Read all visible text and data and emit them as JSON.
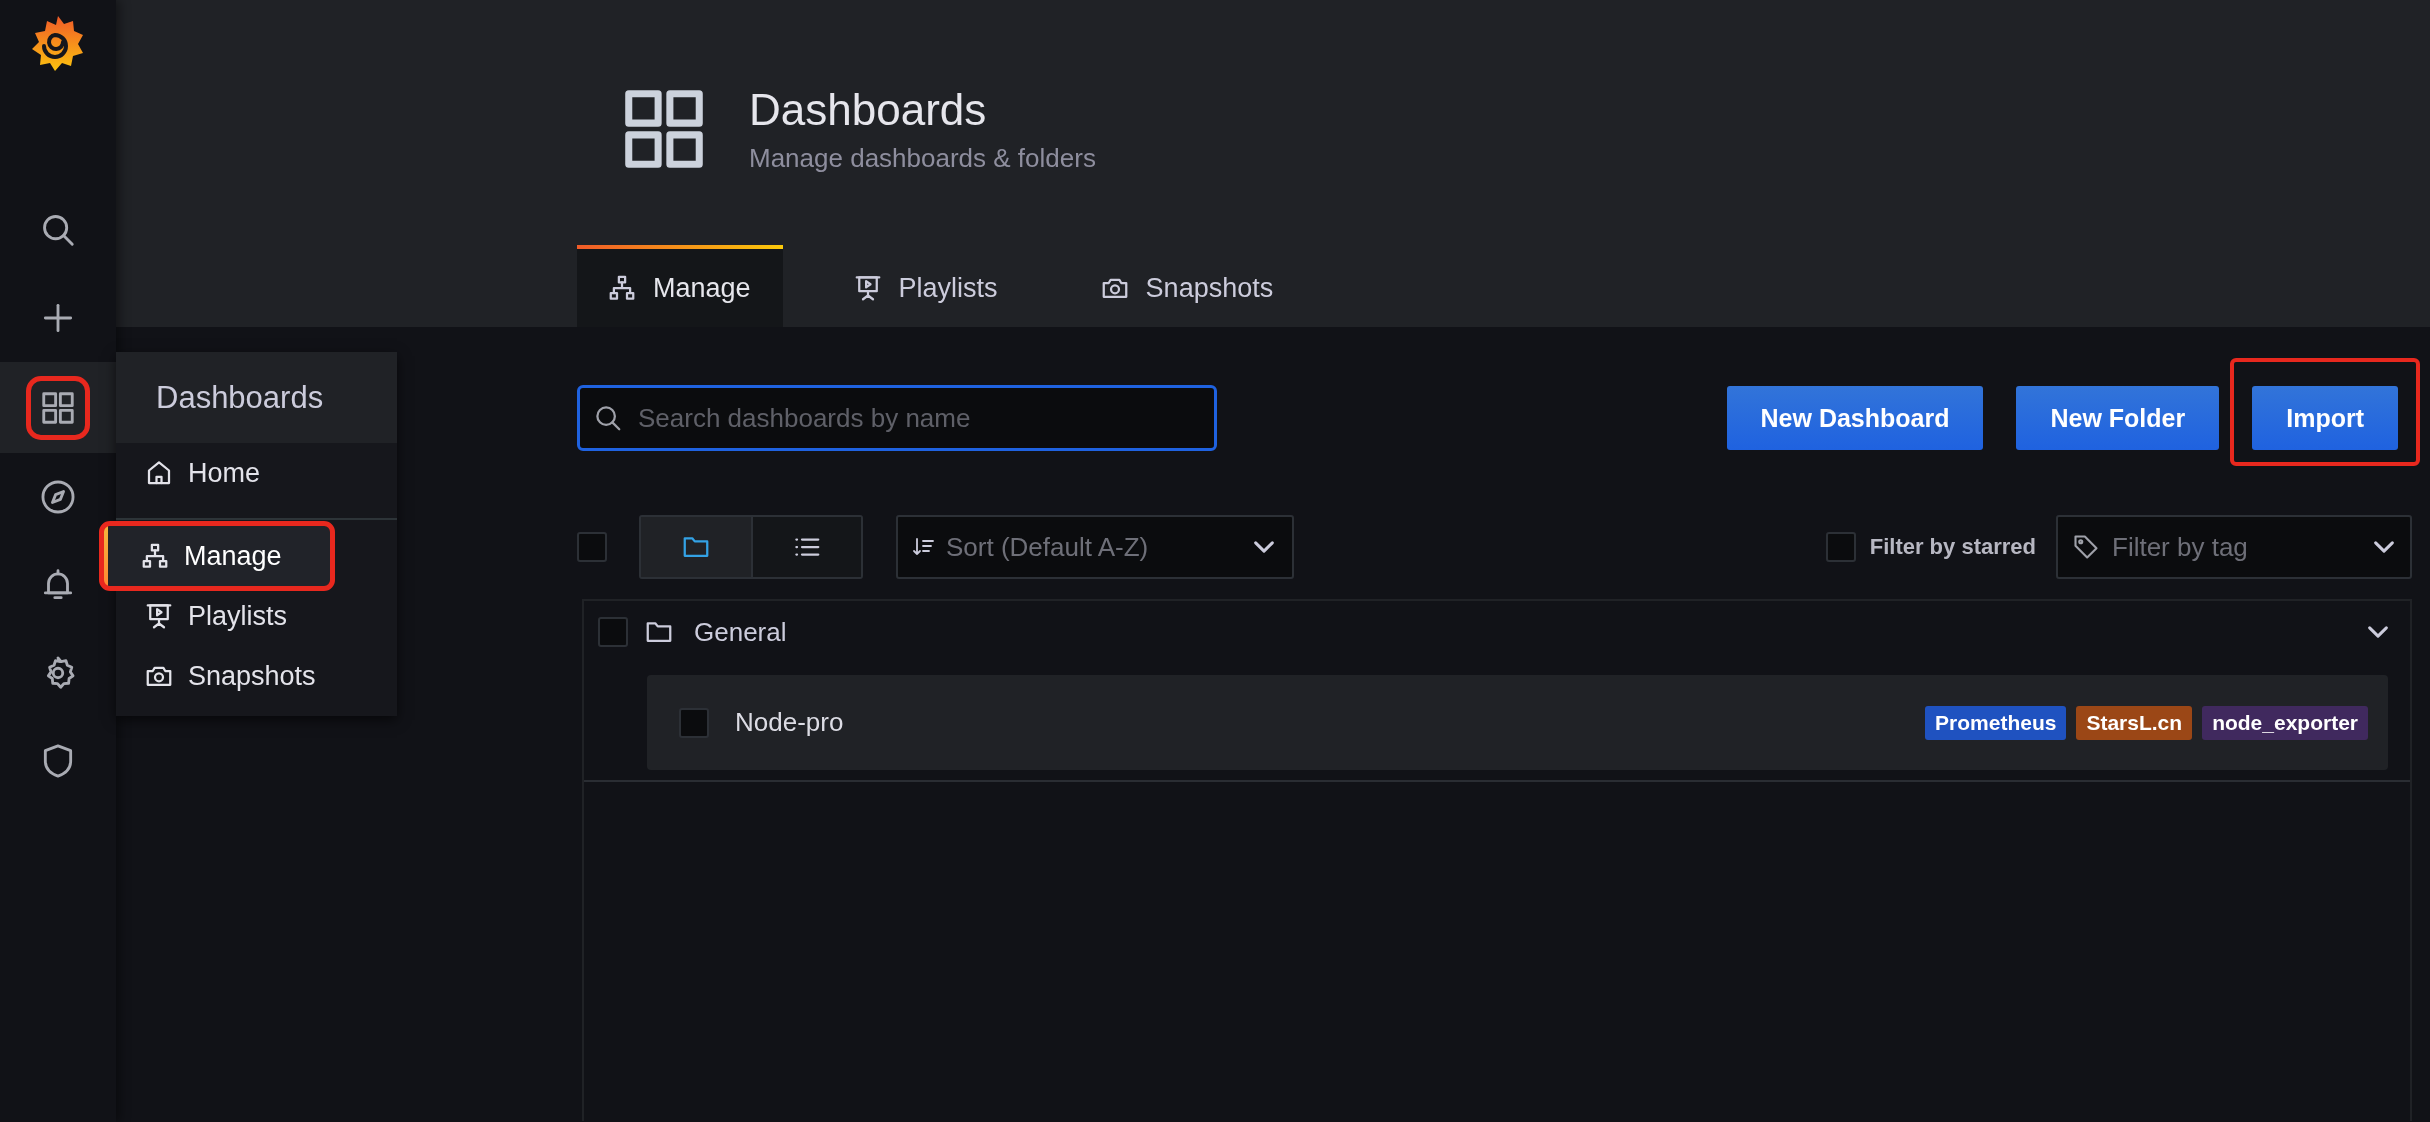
{
  "sidebar": {
    "items": [
      {
        "kind": "search",
        "selected": false,
        "highlighted": false
      },
      {
        "kind": "plus",
        "selected": false,
        "highlighted": false
      },
      {
        "kind": "dashboards",
        "selected": true,
        "highlighted": true
      },
      {
        "kind": "compass",
        "selected": false,
        "highlighted": false
      },
      {
        "kind": "bell",
        "selected": false,
        "highlighted": false
      },
      {
        "kind": "gear",
        "selected": false,
        "highlighted": false
      },
      {
        "kind": "shield",
        "selected": false,
        "highlighted": false
      }
    ]
  },
  "flyout": {
    "title": "Dashboards",
    "items": [
      {
        "label": "Home",
        "kind": "home",
        "selected": false,
        "highlighted": false
      },
      {
        "label": "Manage",
        "kind": "manage",
        "selected": true,
        "highlighted": true
      },
      {
        "label": "Playlists",
        "kind": "playlists",
        "selected": false,
        "highlighted": false
      },
      {
        "label": "Snapshots",
        "kind": "snapshots",
        "selected": false,
        "highlighted": false
      }
    ]
  },
  "header": {
    "title": "Dashboards",
    "subtitle": "Manage dashboards & folders"
  },
  "tabs": [
    {
      "label": "Manage",
      "kind": "manage",
      "selected": true
    },
    {
      "label": "Playlists",
      "kind": "playlists",
      "selected": false
    },
    {
      "label": "Snapshots",
      "kind": "snapshots",
      "selected": false
    }
  ],
  "search": {
    "placeholder": "Search dashboards by name"
  },
  "buttons": [
    {
      "label": "New Dashboard",
      "highlighted": false
    },
    {
      "label": "New Folder",
      "highlighted": false
    },
    {
      "label": "Import",
      "highlighted": true
    }
  ],
  "toolbar": {
    "select_all_checked": false,
    "view_modes": [
      {
        "kind": "folders",
        "selected": true
      },
      {
        "kind": "list",
        "selected": false
      }
    ],
    "sort": {
      "placeholder": "Sort (Default A-Z)"
    },
    "starred_filter": {
      "label": "Filter by starred",
      "checked": false
    },
    "tag_filter": {
      "placeholder": "Filter by tag"
    }
  },
  "folders": [
    {
      "name": "General",
      "checked": false,
      "expanded": true,
      "dashboards": [
        {
          "title": "Node-pro",
          "checked": false,
          "tags": [
            {
              "label": "Prometheus",
              "color": "#1f52c0"
            },
            {
              "label": "StarsL.cn",
              "color": "#9b4716"
            },
            {
              "label": "node_exporter",
              "color": "#40295e"
            }
          ]
        }
      ]
    }
  ]
}
